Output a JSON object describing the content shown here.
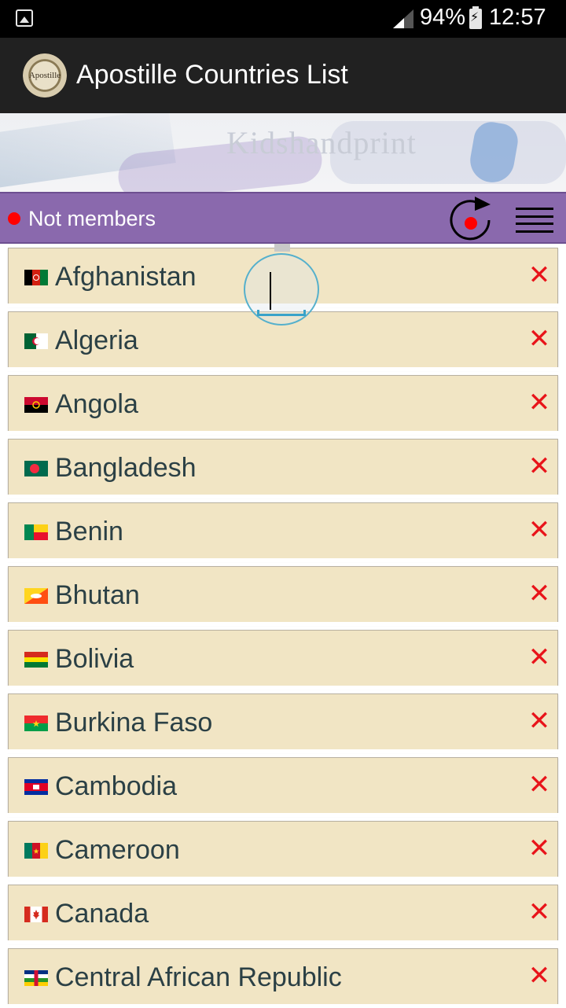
{
  "status_bar": {
    "battery_percent": "94%",
    "time": "12:57"
  },
  "app_bar": {
    "title": "Apostille Countries List",
    "logo_text": "Apostille"
  },
  "banner": {
    "brand": "Kidshandprint"
  },
  "filter": {
    "label": "Not members",
    "indicator_color": "#ff0000"
  },
  "countries": [
    {
      "name": "Afghanistan",
      "flag": "afghanistan-flag-icon"
    },
    {
      "name": "Algeria",
      "flag": "algeria-flag-icon"
    },
    {
      "name": "Angola",
      "flag": "angola-flag-icon"
    },
    {
      "name": "Bangladesh",
      "flag": "bangladesh-flag-icon"
    },
    {
      "name": "Benin",
      "flag": "benin-flag-icon"
    },
    {
      "name": "Bhutan",
      "flag": "bhutan-flag-icon"
    },
    {
      "name": "Bolivia",
      "flag": "bolivia-flag-icon"
    },
    {
      "name": "Burkina Faso",
      "flag": "burkina-faso-flag-icon"
    },
    {
      "name": "Cambodia",
      "flag": "cambodia-flag-icon"
    },
    {
      "name": "Cameroon",
      "flag": "cameroon-flag-icon"
    },
    {
      "name": "Canada",
      "flag": "canada-flag-icon"
    },
    {
      "name": "Central African Republic",
      "flag": "central-african-republic-flag-icon"
    }
  ],
  "colors": {
    "app_bar": "#212121",
    "filter_bar": "#8a69ad",
    "row_background": "#f1e5c4",
    "country_text": "#2b4045",
    "remove_mark": "#e8141a"
  }
}
